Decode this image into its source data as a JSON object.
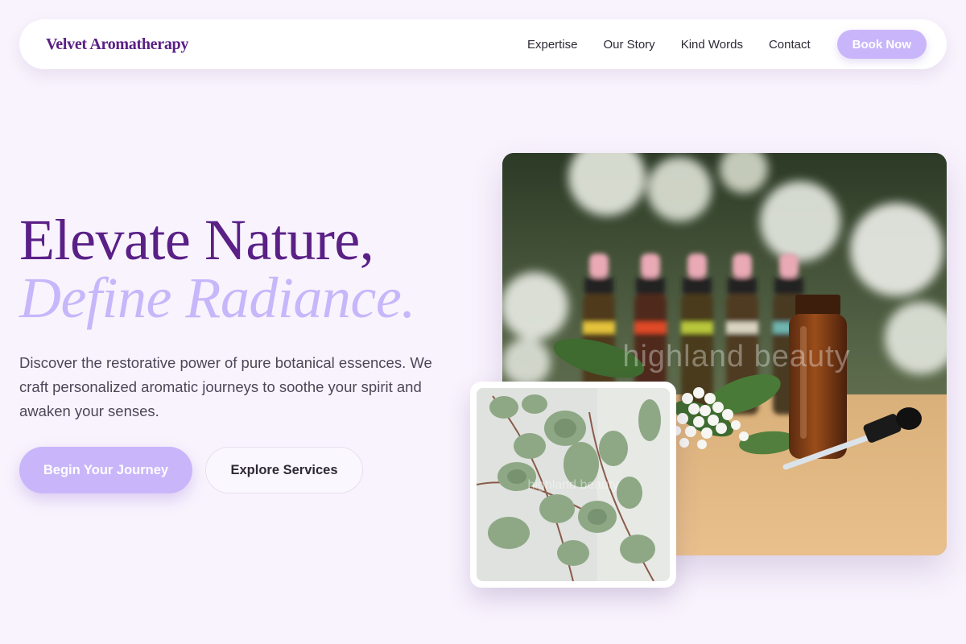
{
  "nav": {
    "brand": "Velvet Aromatherapy",
    "links": [
      "Expertise",
      "Our Story",
      "Kind Words",
      "Contact"
    ],
    "cta": "Book Now"
  },
  "hero": {
    "title_line1": "Elevate Nature,",
    "title_line2": "Define Radiance.",
    "description": "Discover the restorative power of pure botanical essences. We craft personalized aromatic journeys to soothe your spirit and awaken your senses.",
    "primary_cta": "Begin Your Journey",
    "secondary_cta": "Explore Services"
  },
  "images": {
    "main_watermark": "highland beauty",
    "inset_watermark": "highland beauty"
  },
  "colors": {
    "brand": "#5a2086",
    "accent": "#c9b6fa",
    "background": "#f9f3fd"
  }
}
